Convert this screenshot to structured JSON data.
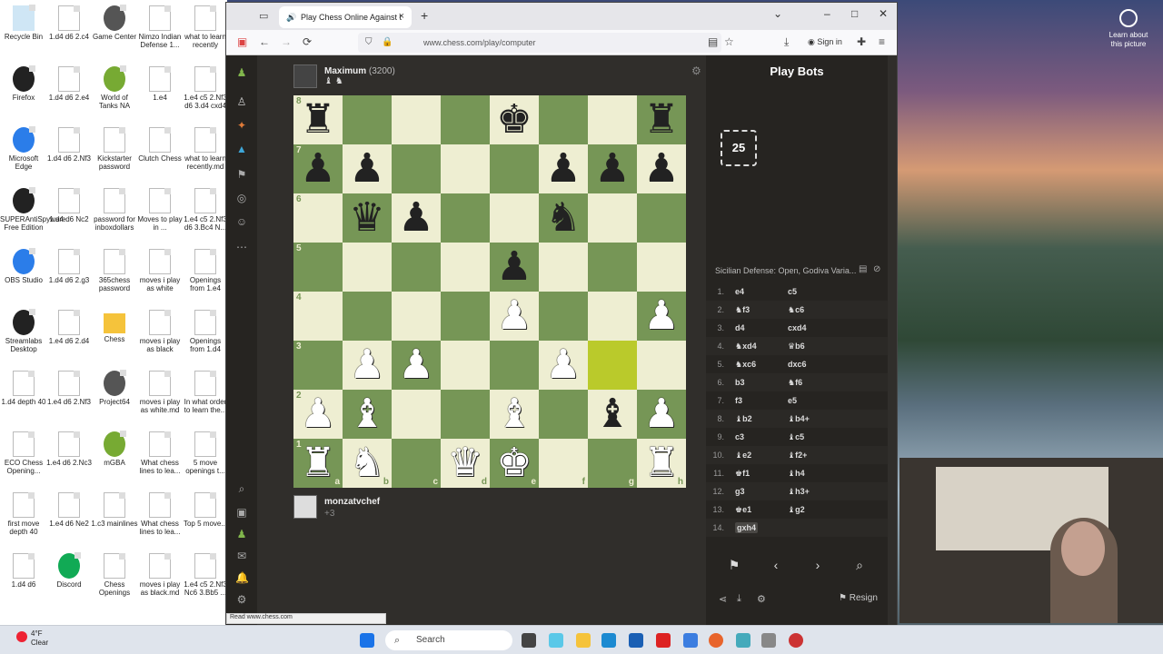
{
  "desktop": {
    "icons": [
      {
        "label": "Recycle Bin",
        "kind": "bin"
      },
      {
        "label": "1.d4 d6 2.c4",
        "kind": "file"
      },
      {
        "label": "Game Center",
        "kind": "round"
      },
      {
        "label": "Nimzo Indian Defense 1...",
        "kind": "file"
      },
      {
        "label": "what to learn recently",
        "kind": "file"
      },
      {
        "label": "Firefox",
        "kind": "round"
      },
      {
        "label": "1.d4 d6 2.e4",
        "kind": "file"
      },
      {
        "label": "World of Tanks NA",
        "kind": "round"
      },
      {
        "label": "1.e4",
        "kind": "file"
      },
      {
        "label": "1.e4 c5 2.Nf3 d6 3.d4 cxd4",
        "kind": "file"
      },
      {
        "label": "Microsoft Edge",
        "kind": "round"
      },
      {
        "label": "1.d4 d6 2.Nf3",
        "kind": "file"
      },
      {
        "label": "Kickstarter password",
        "kind": "file"
      },
      {
        "label": "Clutch Chess",
        "kind": "file"
      },
      {
        "label": "what to learn recently.md",
        "kind": "file"
      },
      {
        "label": "SUPERAntiSpyware Free Edition",
        "kind": "round"
      },
      {
        "label": "1.d4 d6 Nc2",
        "kind": "file"
      },
      {
        "label": "password for inboxdollars",
        "kind": "file"
      },
      {
        "label": "Moves to play in ...",
        "kind": "file"
      },
      {
        "label": "1.e4 c5 2.Nf3 d6 3.Bc4 N...",
        "kind": "file"
      },
      {
        "label": "OBS Studio",
        "kind": "round"
      },
      {
        "label": "1.d4 d6 2.g3",
        "kind": "file"
      },
      {
        "label": "365chess password",
        "kind": "file"
      },
      {
        "label": "moves i play as white",
        "kind": "file"
      },
      {
        "label": "Openings from 1.e4",
        "kind": "file"
      },
      {
        "label": "Streamlabs Desktop",
        "kind": "round"
      },
      {
        "label": "1.e4 d6 2.d4",
        "kind": "file"
      },
      {
        "label": "Chess",
        "kind": "folder"
      },
      {
        "label": "moves i play as black",
        "kind": "file"
      },
      {
        "label": "Openings from 1.d4",
        "kind": "file"
      },
      {
        "label": "1.d4 depth 40",
        "kind": "file"
      },
      {
        "label": "1.e4 d6 2.Nf3",
        "kind": "file"
      },
      {
        "label": "Project64",
        "kind": "round"
      },
      {
        "label": "moves i play as white.md",
        "kind": "file"
      },
      {
        "label": "In what order to learn the...",
        "kind": "file"
      },
      {
        "label": "ECO Chess Opening...",
        "kind": "file"
      },
      {
        "label": "1.e4 d6 2.Nc3",
        "kind": "file"
      },
      {
        "label": "mGBA",
        "kind": "round"
      },
      {
        "label": "What chess lines to lea...",
        "kind": "file"
      },
      {
        "label": "5 move openings t...",
        "kind": "file"
      },
      {
        "label": "first move depth 40",
        "kind": "file"
      },
      {
        "label": "1.e4 d6 Ne2",
        "kind": "file"
      },
      {
        "label": "1.c3 mainlines",
        "kind": "file"
      },
      {
        "label": "What chess lines to lea...",
        "kind": "file"
      },
      {
        "label": "Top 5 move...",
        "kind": "file"
      },
      {
        "label": "1.d4 d6",
        "kind": "file"
      },
      {
        "label": "Discord",
        "kind": "round"
      },
      {
        "label": "Chess Openings",
        "kind": "file"
      },
      {
        "label": "moves i play as black.md",
        "kind": "file"
      },
      {
        "label": "1.e4 c5 2.Nf3 Nc6 3.Bb5 ...",
        "kind": "file"
      }
    ]
  },
  "browser": {
    "tab_title": "Play Chess Online Against t",
    "url": "www.chess.com/play/computer",
    "sign_in": "Sign in",
    "status_link": "Read www.chess.com"
  },
  "game": {
    "opponent": {
      "name": "Maximum",
      "rating": "(3200)",
      "icons": "♝ ♞"
    },
    "player": {
      "name": "monzatvchef",
      "material": "+3"
    },
    "board": [
      [
        "bR",
        "",
        "",
        "",
        "bK",
        "",
        "",
        "bR"
      ],
      [
        "bP",
        "bP",
        "",
        "",
        "",
        "bP",
        "bP",
        "bP"
      ],
      [
        "",
        "bQ",
        "bP",
        "",
        "",
        "bN",
        "",
        ""
      ],
      [
        "",
        "",
        "",
        "",
        "bP",
        "",
        "",
        ""
      ],
      [
        "",
        "",
        "",
        "",
        "wP",
        "",
        "",
        "wP"
      ],
      [
        "",
        "wP",
        "wP",
        "",
        "",
        "wP",
        "",
        ""
      ],
      [
        "wP",
        "wB",
        "",
        "",
        "wB",
        "",
        "bB",
        "wP"
      ],
      [
        "wR",
        "wN",
        "",
        "wQ",
        "wK",
        "",
        "",
        "wR"
      ]
    ],
    "highlight": [
      "g3"
    ],
    "ranks": [
      "8",
      "7",
      "6",
      "5",
      "4",
      "3",
      "2",
      "1"
    ],
    "files": [
      "a",
      "b",
      "c",
      "d",
      "e",
      "f",
      "g",
      "h"
    ]
  },
  "panel": {
    "title": "Play Bots",
    "bot_level": "25",
    "opening": "Sicilian Defense: Open, Godiva Varia...",
    "moves": [
      {
        "n": "1.",
        "w": "e4",
        "b": "c5"
      },
      {
        "n": "2.",
        "w": "♞f3",
        "b": "♞c6"
      },
      {
        "n": "3.",
        "w": "d4",
        "b": "cxd4"
      },
      {
        "n": "4.",
        "w": "♞xd4",
        "b": "♛b6"
      },
      {
        "n": "5.",
        "w": "♞xc6",
        "b": "dxc6"
      },
      {
        "n": "6.",
        "w": "b3",
        "b": "♞f6"
      },
      {
        "n": "7.",
        "w": "f3",
        "b": "e5"
      },
      {
        "n": "8.",
        "w": "♝b2",
        "b": "♝b4+"
      },
      {
        "n": "9.",
        "w": "c3",
        "b": "♝c5"
      },
      {
        "n": "10.",
        "w": "♝e2",
        "b": "♝f2+"
      },
      {
        "n": "11.",
        "w": "♚f1",
        "b": "♝h4"
      },
      {
        "n": "12.",
        "w": "g3",
        "b": "♝h3+"
      },
      {
        "n": "13.",
        "w": "♚e1",
        "b": "♝g2"
      },
      {
        "n": "14.",
        "w": "gxh4",
        "b": ""
      }
    ],
    "resign": "Resign"
  },
  "taskbar": {
    "weather_temp": "4°F",
    "weather_desc": "Clear",
    "search": "Search"
  },
  "lens": "Learn about this picture"
}
